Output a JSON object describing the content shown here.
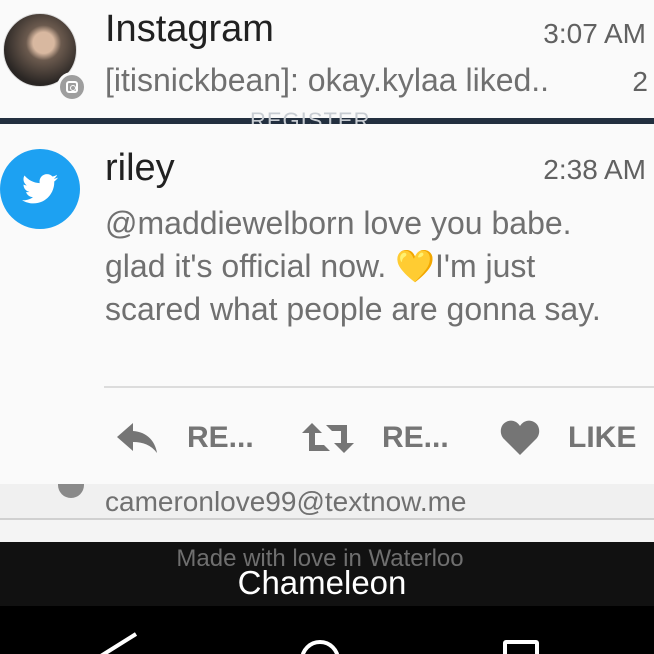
{
  "instagram": {
    "app_name": "Instagram",
    "time": "3:07 AM",
    "preview": "[itisnickbean]: okay.kylaa liked..",
    "count": "2"
  },
  "background_strip": {
    "text": "REGISTER"
  },
  "twitter": {
    "sender": "riley",
    "time": "2:38 AM",
    "body_before": "@maddiewelborn love you babe. glad it's official now. ",
    "heart": "💛",
    "body_after": "I'm just scared what people are gonna say.",
    "actions": [
      {
        "label": "RE...",
        "icon": "reply-icon"
      },
      {
        "label": "RE...",
        "icon": "retweet-icon"
      },
      {
        "label": "LIKE",
        "icon": "heart-icon"
      }
    ]
  },
  "behind_notification": {
    "text": "cameronlove99@textnow.me"
  },
  "footer": {
    "made_with": "Made with love in Waterloo",
    "app_label": "Chameleon"
  },
  "colors": {
    "twitter_blue": "#1da1f2",
    "card_bg": "#fafafa",
    "secondary_text": "#707070"
  }
}
